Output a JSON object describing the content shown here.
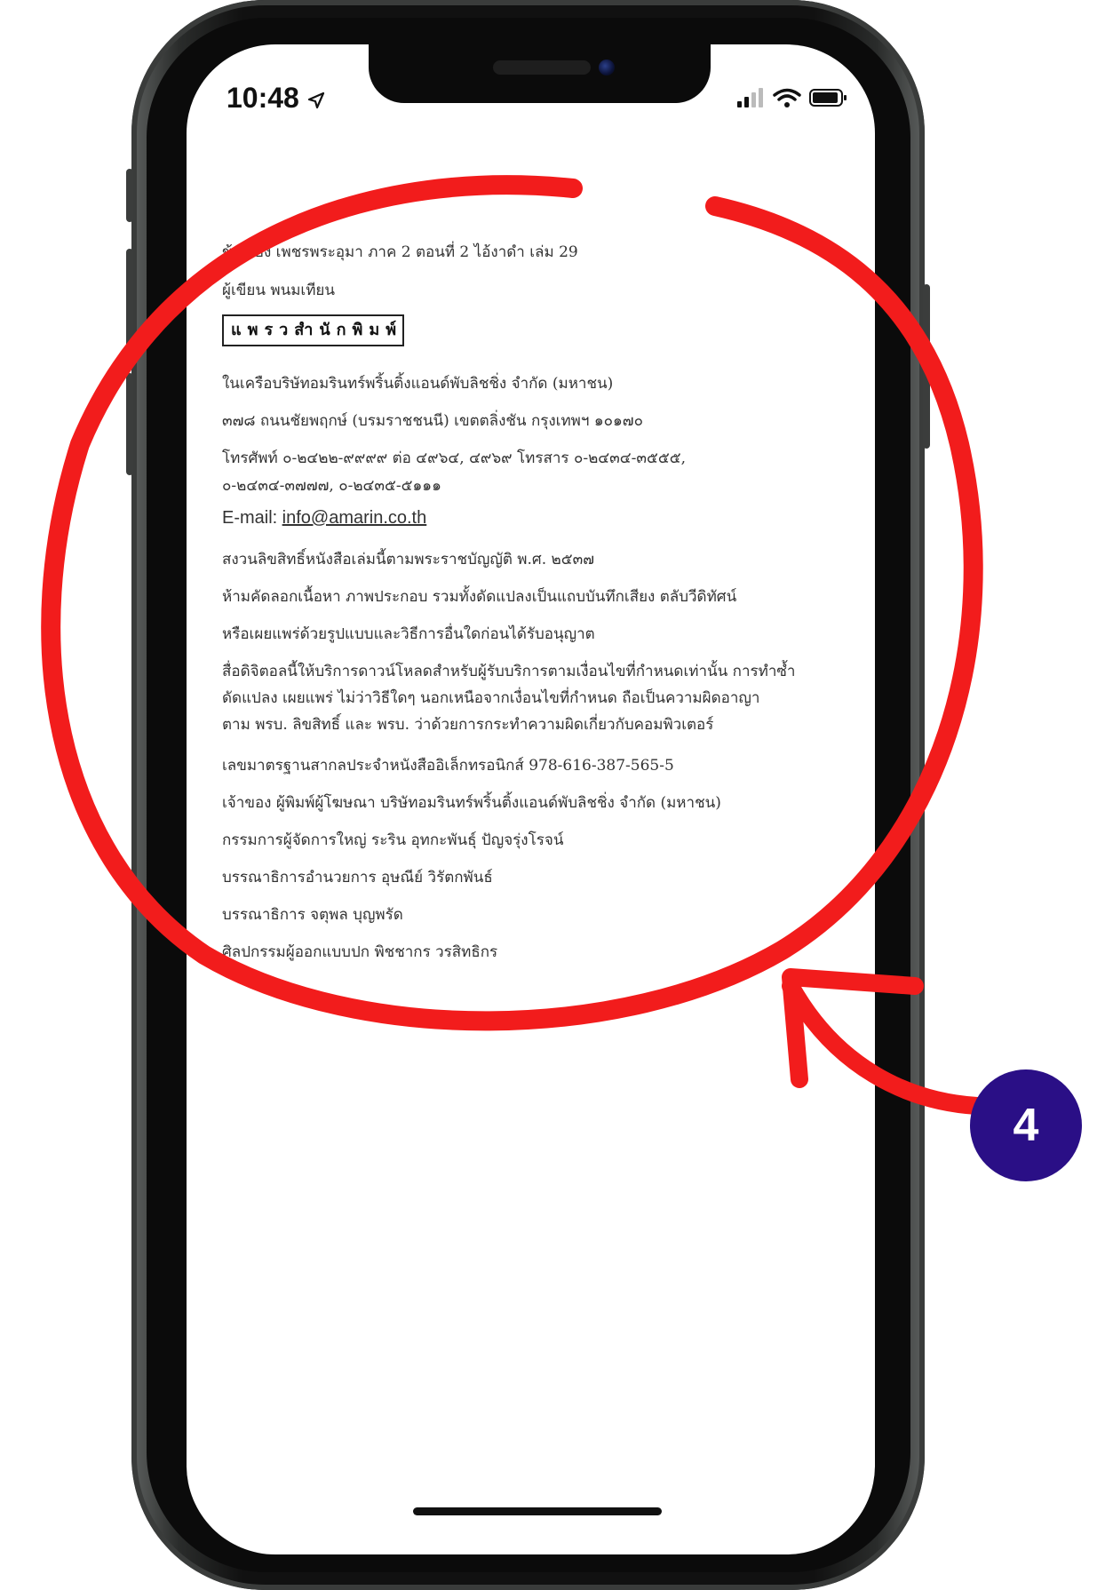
{
  "status_bar": {
    "time": "10:48"
  },
  "document": {
    "lines": [
      "ข้อเรื่อง เพชรพระอุมา ภาค 2 ตอนที่ 2 ไอ้งาดำ เล่ม 29",
      "ผู้เขียน พนมเทียน"
    ],
    "logo_text": "แพรวสำนักพิมพ์",
    "company_lines": [
      "ในเครือบริษัทอมรินทร์พริ้นติ้งแอนด์พับลิชชิ่ง จำกัด (มหาชน)",
      "๓๗๘ ถนนชัยพฤกษ์ (บรมราชชนนี) เขตตลิ่งชัน กรุงเทพฯ ๑๐๑๗๐",
      "โทรศัพท์ ๐-๒๔๒๒-๙๙๙๙ ต่อ ๔๙๖๔, ๔๙๖๙ โทรสาร ๐-๒๔๓๔-๓๕๕๕,",
      "๐-๒๔๓๔-๓๗๗๗, ๐-๒๔๓๕-๕๑๑๑"
    ],
    "email_label": "E-mail:",
    "email": "info@amarin.co.th",
    "rights_lines": [
      "สงวนลิขสิทธิ์หนังสือเล่มนี้ตามพระราชบัญญัติ พ.ศ. ๒๕๓๗",
      "ห้ามคัดลอกเนื้อหา ภาพประกอบ รวมทั้งดัดแปลงเป็นแถบบันทึกเสียง ตลับวีดิทัศน์",
      "หรือเผยแพร่ด้วยรูปแบบและวิธีการอื่นใดก่อนได้รับอนุญาต"
    ],
    "digital_notice": [
      "สื่อดิจิตอลนี้ให้บริการดาวน์โหลดสำหรับผู้รับบริการตามเงื่อนไขที่กำหนดเท่านั้น การทำซ้ำ",
      "ดัดแปลง เผยแพร่ ไม่ว่าวิธีใดๆ นอกเหนือจากเงื่อนไขที่กำหนด ถือเป็นความผิดอาญา",
      "ตาม พรบ. ลิขสิทธิ์ และ พรบ. ว่าด้วยการกระทำความผิดเกี่ยวกับคอมพิวเตอร์"
    ],
    "credits": [
      "เลขมาตรฐานสากลประจำหนังสืออิเล็กทรอนิกส์ 978-616-387-565-5",
      "เจ้าของ ผู้พิมพ์ผู้โฆษณา บริษัทอมรินทร์พริ้นติ้งแอนด์พับลิชชิ่ง จำกัด (มหาชน)",
      "กรรมการผู้จัดการใหญ่ ระริน อุทกะพันธุ์ ปัญจรุ่งโรจน์",
      "บรรณาธิการอำนวยการ อุษณีย์ วิรัตกพันธ์",
      "บรรณาธิการ จตุพล บุญพรัด",
      "ศิลปกรรมผู้ออกแบบปก พิชชากร วรสิทธิกร"
    ]
  },
  "annotation": {
    "step_number": "4",
    "color": "#f21c1c",
    "badge_color": "#2a0f86"
  }
}
